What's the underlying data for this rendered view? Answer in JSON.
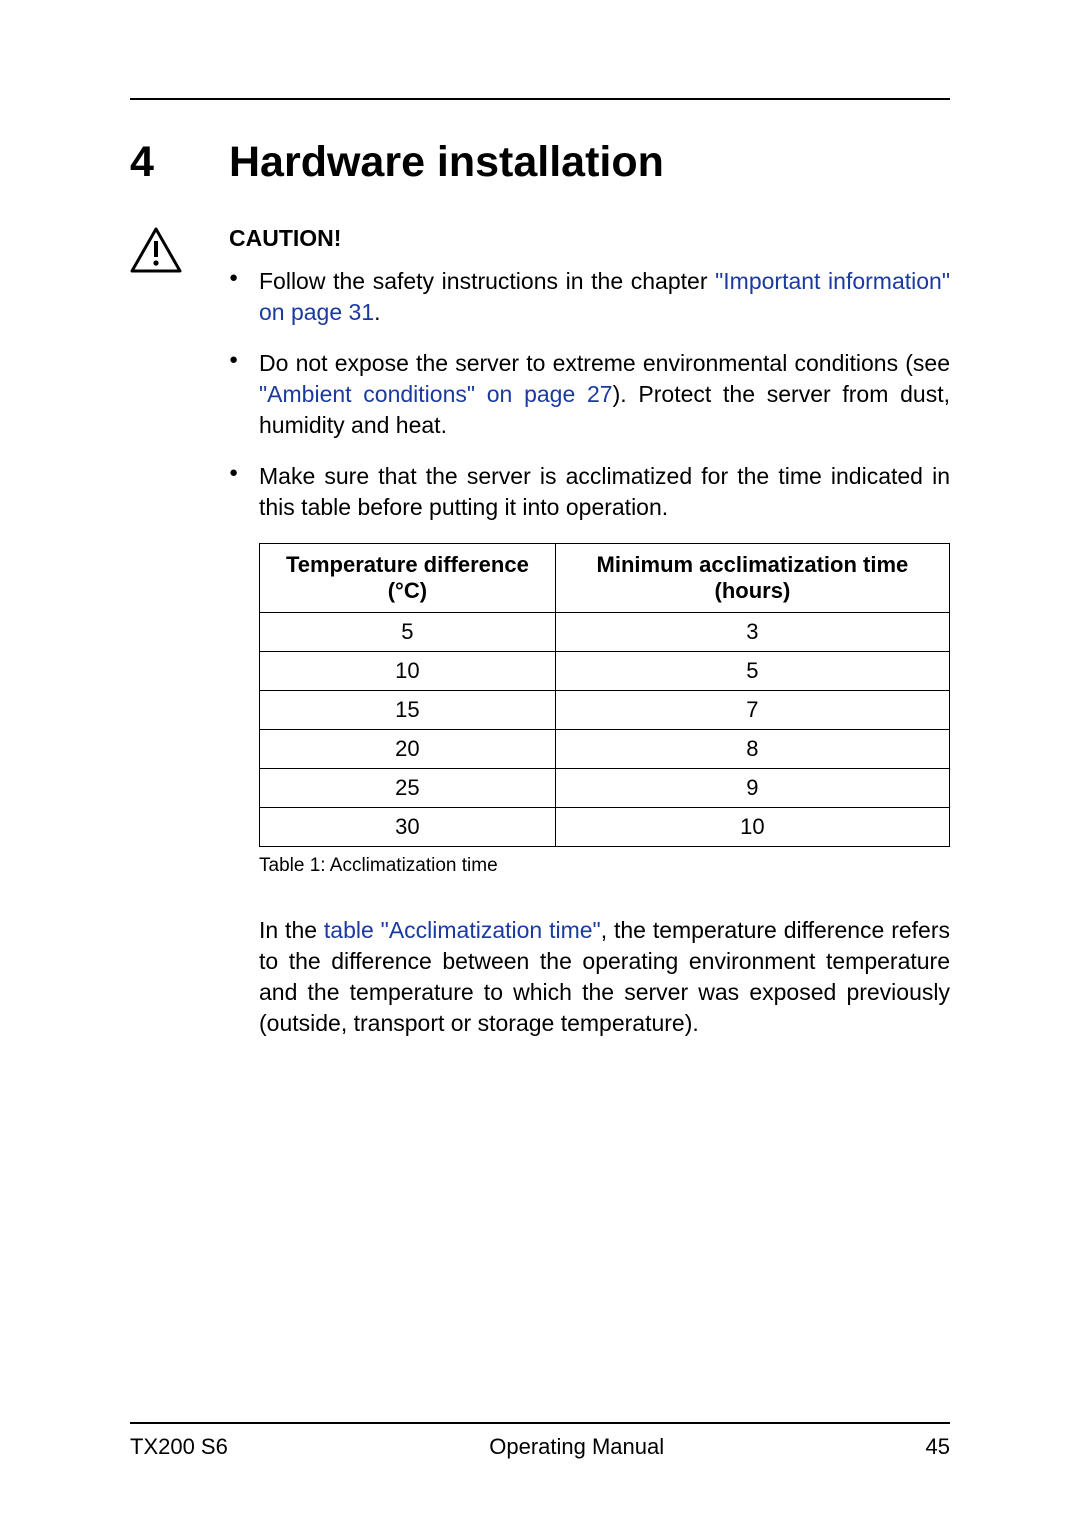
{
  "chapter": {
    "number": "4",
    "title": "Hardware installation"
  },
  "caution": {
    "label": "CAUTION!",
    "bullets": {
      "b1": {
        "pre": "Follow the safety instructions in the chapter ",
        "link": "\"Important information\" on page 31",
        "post": "."
      },
      "b2": {
        "pre": "Do not expose the server to extreme environmental conditions (see ",
        "link": "\"Ambient conditions\" on page 27",
        "post": "). Protect the server from dust, humidity and heat."
      },
      "b3": {
        "text": "Make sure that the server is acclimatized for the time indicated in this table before putting it into operation."
      }
    }
  },
  "table": {
    "headers": {
      "col1": "Temperature difference (°C)",
      "col2": "Minimum acclimatization time (hours)"
    },
    "rows": [
      {
        "c1": "5",
        "c2": "3"
      },
      {
        "c1": "10",
        "c2": "5"
      },
      {
        "c1": "15",
        "c2": "7"
      },
      {
        "c1": "20",
        "c2": "8"
      },
      {
        "c1": "25",
        "c2": "9"
      },
      {
        "c1": "30",
        "c2": "10"
      }
    ],
    "caption": "Table 1: Acclimatization time"
  },
  "followup": {
    "pre": "In the ",
    "link": "table \"Acclimatization time\"",
    "post": ", the temperature difference refers to the difference between the operating environment temperature and the temperature to which the server was exposed previously (outside, transport or storage temperature)."
  },
  "footer": {
    "left": "TX200 S6",
    "center": "Operating Manual",
    "right": "45"
  },
  "chart_data": {
    "type": "table",
    "title": "Acclimatization time",
    "columns": [
      "Temperature difference (°C)",
      "Minimum acclimatization time (hours)"
    ],
    "rows": [
      [
        5,
        3
      ],
      [
        10,
        5
      ],
      [
        15,
        7
      ],
      [
        20,
        8
      ],
      [
        25,
        9
      ],
      [
        30,
        10
      ]
    ]
  }
}
